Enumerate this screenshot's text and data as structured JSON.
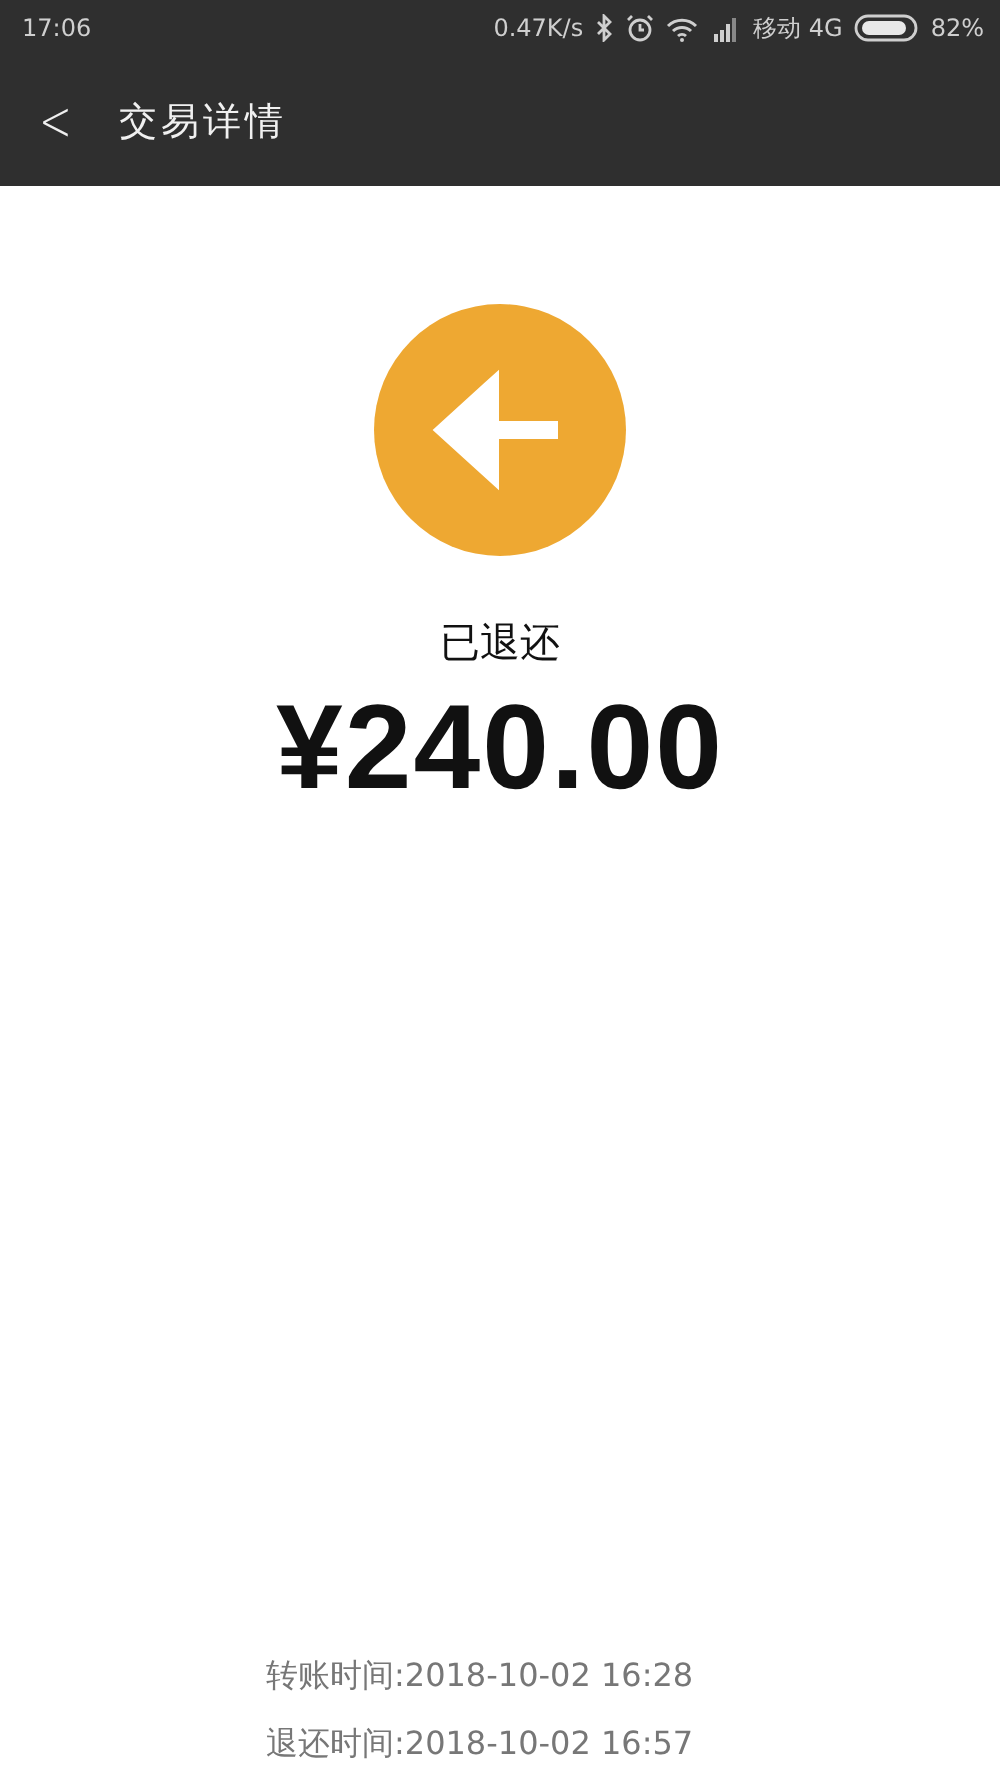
{
  "status_bar": {
    "time": "17:06",
    "speed": "0.47K/s",
    "carrier": "移动 4G",
    "battery": "82%"
  },
  "header": {
    "back": "<",
    "title": "交易详情"
  },
  "result": {
    "status": "已退还",
    "amount": "¥240.00"
  },
  "details": [
    {
      "label": "转账时间:",
      "value": "2018-10-02 16:28"
    },
    {
      "label": "退还时间:",
      "value": "2018-10-02 16:57"
    }
  ]
}
